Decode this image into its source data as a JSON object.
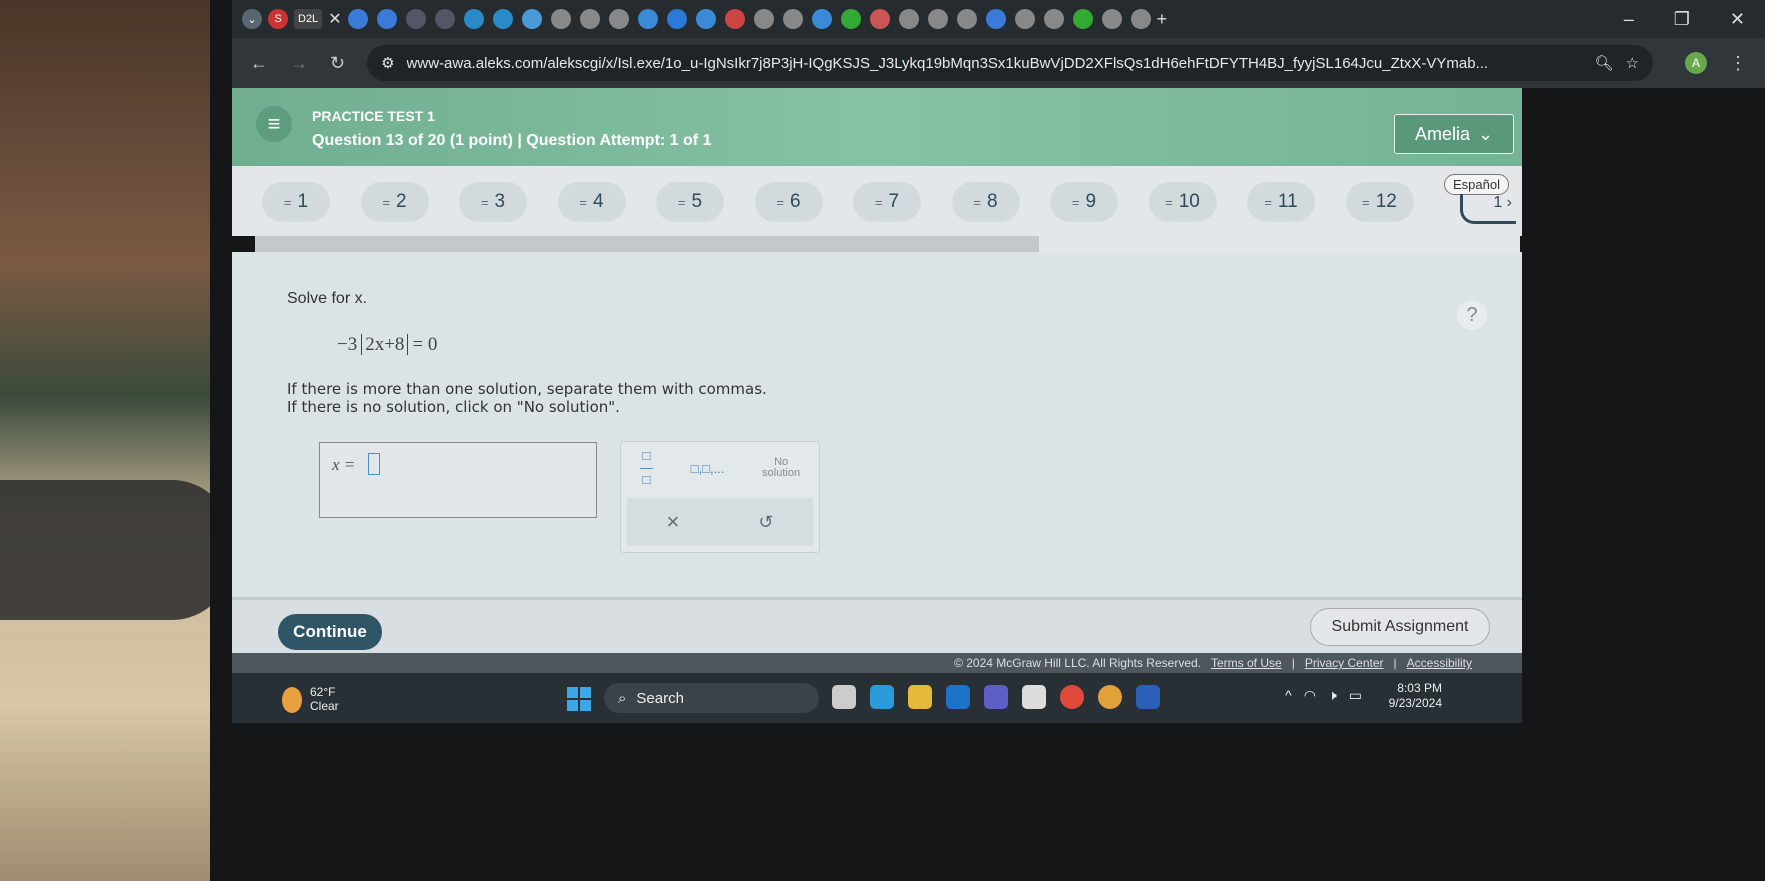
{
  "browser": {
    "tab_count_icons": 28,
    "new_tab": "+",
    "url": "www-awa.aleks.com/alekscgi/x/Isl.exe/1o_u-IgNsIkr7j8P3jH-IQgKSJS_J3Lykq19bMqn3Sx1kuBwVjDD2XFlsQs1dH6ehFtDFYTH4BJ_fyyjSL164Jcu_ZtxX-VYmab...",
    "profile_initial": "A",
    "active_tab_label": "D2L"
  },
  "header": {
    "title": "PRACTICE TEST 1",
    "subtitle": "Question 13 of 20 (1 point)  |  Question Attempt: 1 of 1",
    "user": "Amelia"
  },
  "question_nav": {
    "items": [
      "1",
      "2",
      "3",
      "4",
      "5",
      "6",
      "7",
      "8",
      "9",
      "10",
      "11",
      "12"
    ],
    "more": "1",
    "language": "Español"
  },
  "progress": {
    "fraction": 0.62
  },
  "question": {
    "prompt": "Solve for x.",
    "coef": "−3",
    "inside": "2x+8",
    "rhs": "= 0",
    "instruction1": "If there is more than one solution, separate them with commas.",
    "instruction2": "If there is no solution, click on \"No solution\".",
    "answer_label": "x ="
  },
  "keypad": {
    "list": "□,□,...",
    "no_solution_1": "No",
    "no_solution_2": "solution",
    "clear": "×",
    "undo": "↺"
  },
  "help": "?",
  "footer": {
    "continue": "Continue",
    "submit": "Submit Assignment",
    "copyright": "© 2024 McGraw Hill LLC. All Rights Reserved.",
    "terms": "Terms of Use",
    "privacy": "Privacy Center",
    "accessibility": "Accessibility"
  },
  "taskbar": {
    "temp": "62°F",
    "weather": "Clear",
    "search": "Search",
    "time": "8:03 PM",
    "date": "9/23/2024",
    "colors": {
      "accent": "#2f5566",
      "header": "#7fbfa0"
    }
  }
}
